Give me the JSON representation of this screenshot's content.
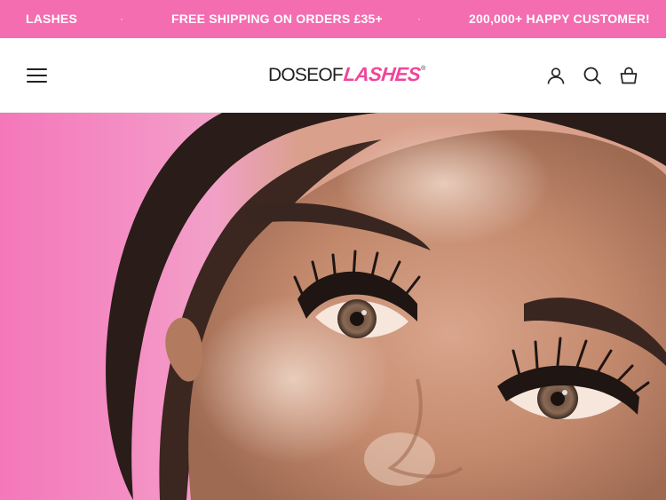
{
  "announcement_bar": {
    "messages": [
      "LASHES",
      "FREE SHIPPING ON ORDERS £35+",
      "200,000+ HAPPY CUSTOMER!"
    ],
    "separator": "·",
    "background": "#f36db0"
  },
  "header": {
    "logo": {
      "part1": "DOSEOF",
      "part2": "LASHES",
      "registered": "®",
      "accent_color": "#f0469a"
    },
    "icons": [
      "menu-icon",
      "account-icon",
      "search-icon",
      "cart-icon"
    ]
  },
  "hero": {
    "image": "close-up of a woman's face wearing fluffy false eyelashes against a pink background",
    "background": "#f48fc4"
  }
}
